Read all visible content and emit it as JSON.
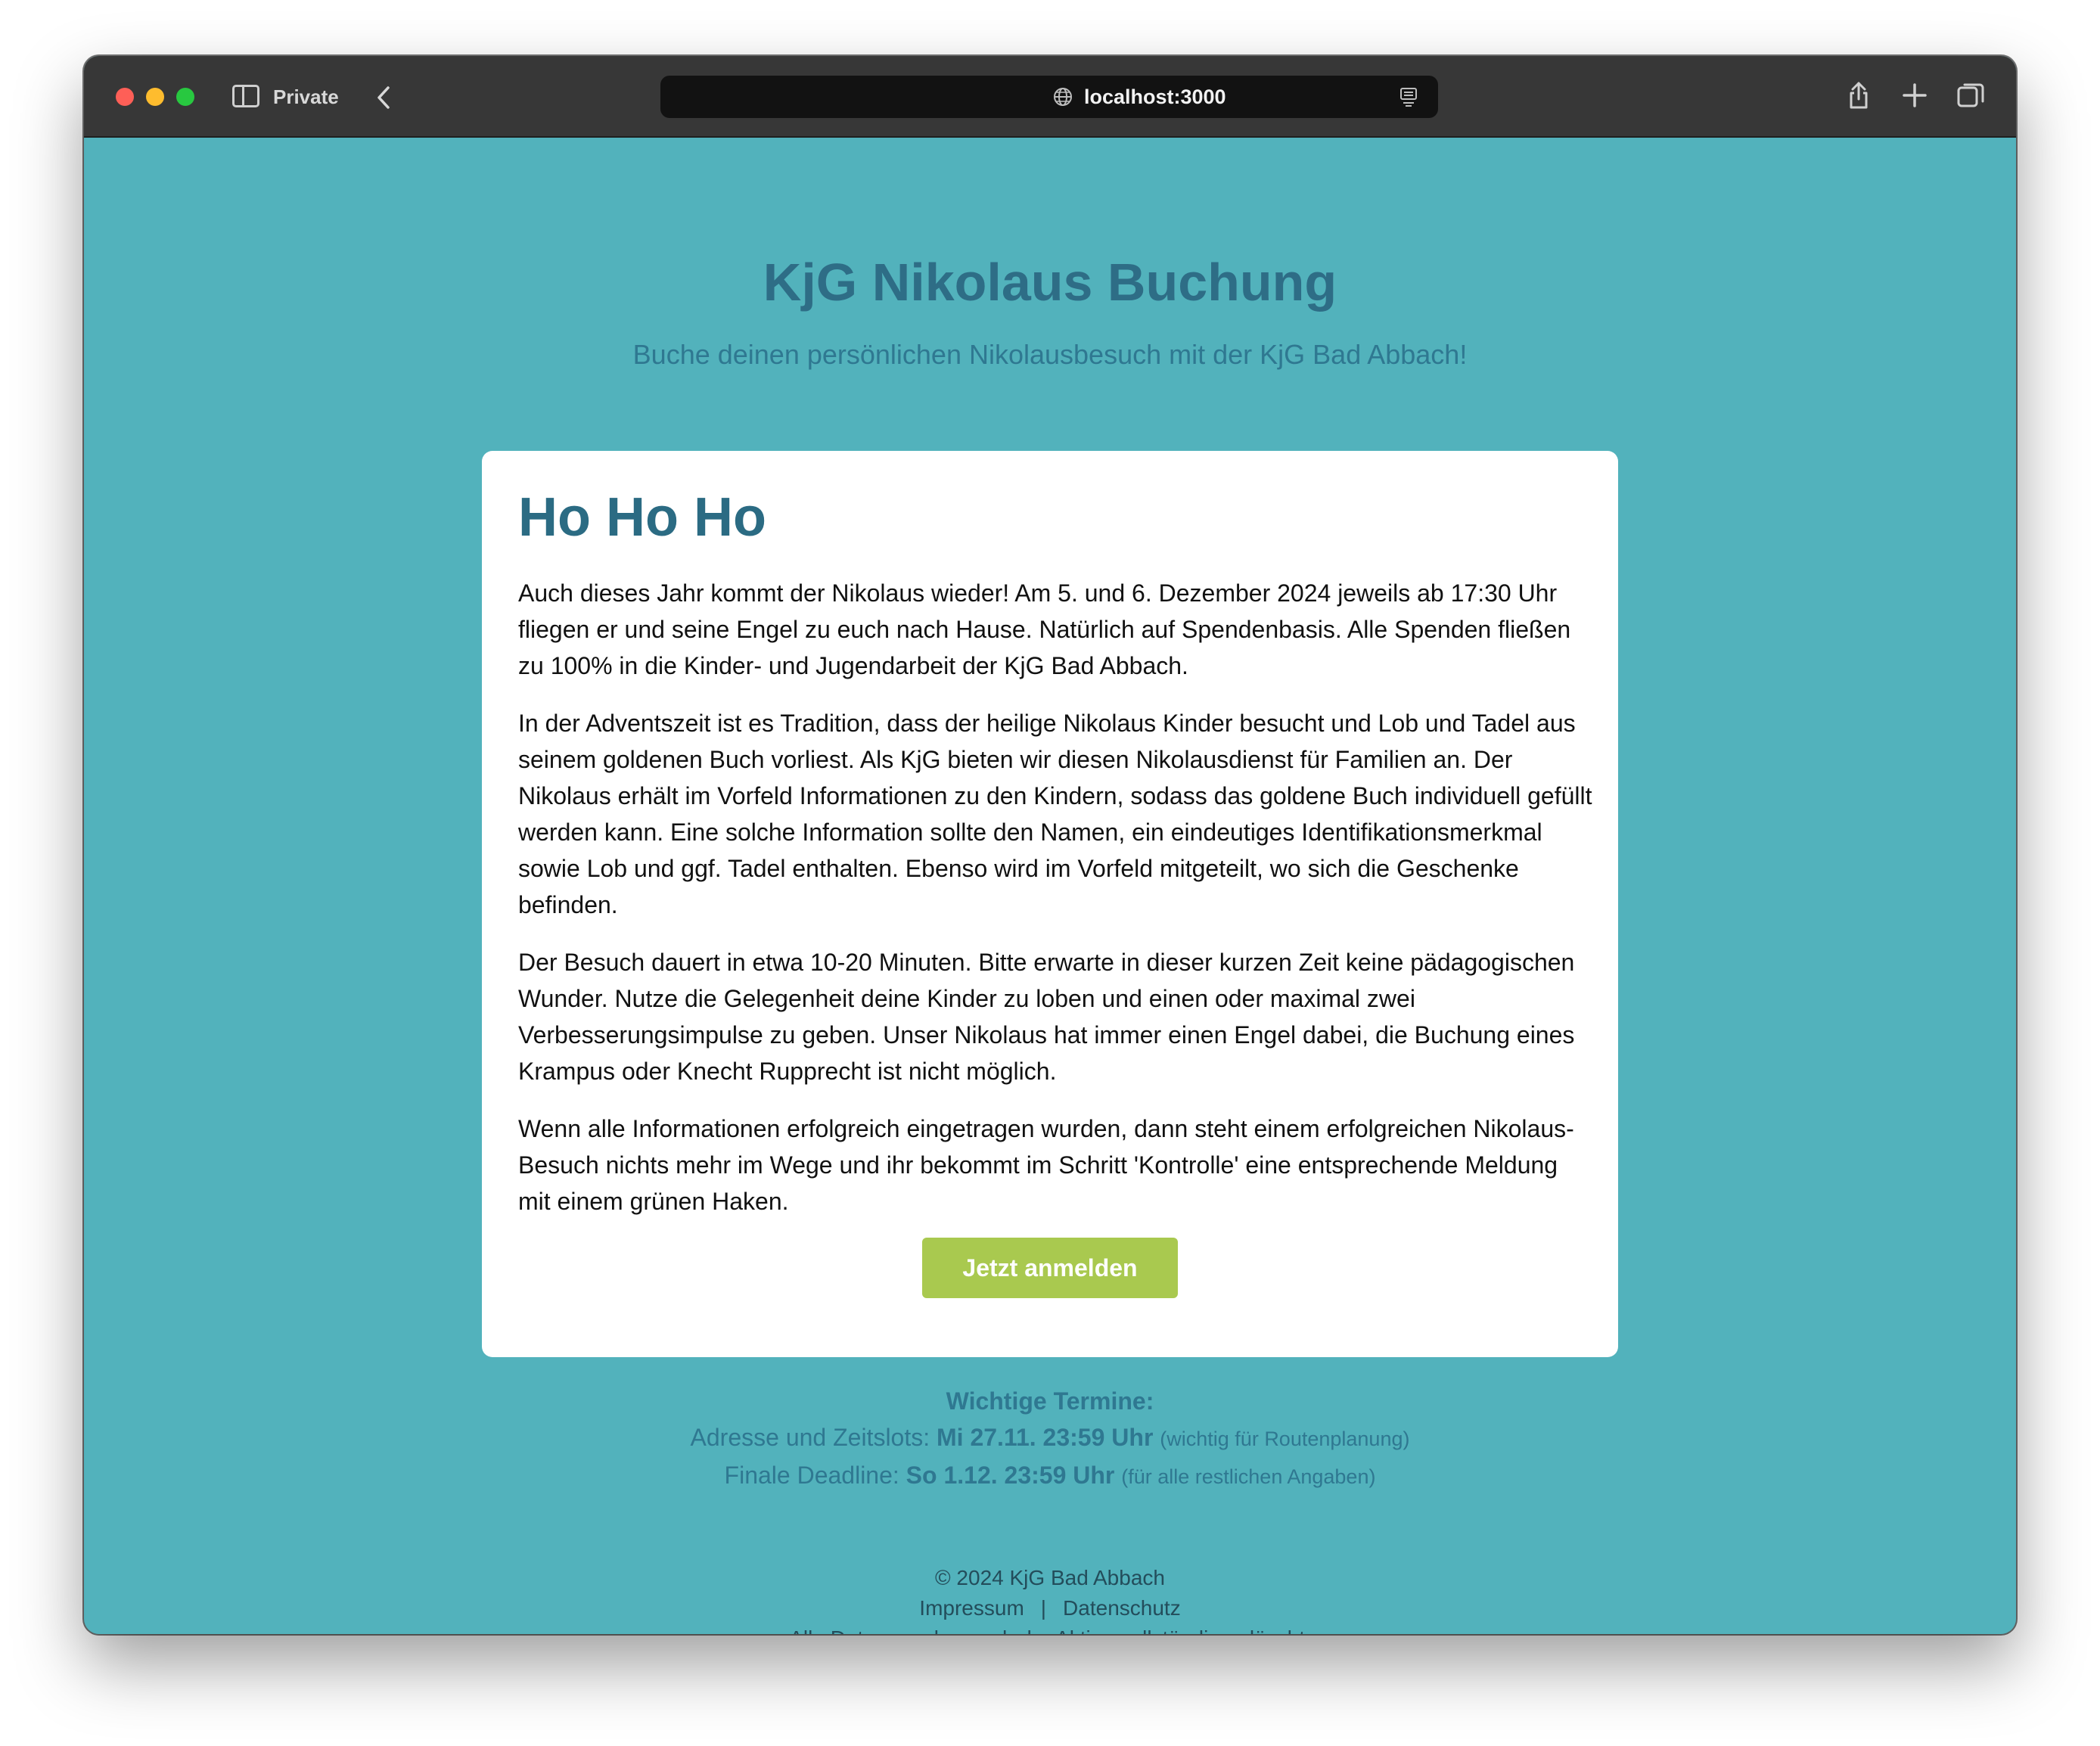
{
  "browser": {
    "mode_label": "Private",
    "url": "localhost:3000"
  },
  "header": {
    "title": "KjG Nikolaus Buchung",
    "subtitle": "Buche deinen persönlichen Nikolausbesuch mit der KjG Bad Abbach!"
  },
  "card": {
    "title": "Ho Ho Ho",
    "paragraphs": [
      "Auch dieses Jahr kommt der Nikolaus wieder! Am 5. und 6. Dezember 2024 jeweils ab 17:30 Uhr fliegen er und seine Engel zu euch nach Hause. Natürlich auf Spendenbasis. Alle Spenden fließen zu 100% in die Kinder- und Jugendarbeit der KjG Bad Abbach.",
      "In der Adventszeit ist es Tradition, dass der heilige Nikolaus Kinder besucht und Lob und Tadel aus seinem goldenen Buch vorliest. Als KjG bieten wir diesen Nikolausdienst für Familien an. Der Nikolaus erhält im Vorfeld Informationen zu den Kindern, sodass das goldene Buch individuell gefüllt werden kann. Eine solche Information sollte den Namen, ein eindeutiges Identifikationsmerkmal sowie Lob und ggf. Tadel enthalten. Ebenso wird im Vorfeld mitgeteilt, wo sich die Geschenke befinden.",
      "Der Besuch dauert in etwa 10-20 Minuten. Bitte erwarte in dieser kurzen Zeit keine pädagogischen Wunder. Nutze die Gelegenheit deine Kinder zu loben und einen oder maximal zwei Verbesserungsimpulse zu geben. Unser Nikolaus hat immer einen Engel dabei, die Buchung eines Krampus oder Knecht Rupprecht ist nicht möglich.",
      "Wenn alle Informationen erfolgreich eingetragen wurden, dann steht einem erfolgreichen Nikolaus-Besuch nichts mehr im Wege und ihr bekommt im Schritt 'Kontrolle' eine entsprechende Meldung mit einem grünen Haken."
    ],
    "button_label": "Jetzt anmelden"
  },
  "dates": {
    "heading": "Wichtige Termine:",
    "items": [
      {
        "label": "Adresse und Zeitslots:",
        "value": "Mi 27.11. 23:59 Uhr",
        "note": "(wichtig für Routenplanung)"
      },
      {
        "label": "Finale Deadline:",
        "value": "So 1.12. 23:59 Uhr",
        "note": "(für alle restlichen Angaben)"
      }
    ]
  },
  "footer": {
    "copyright": "© 2024 KjG Bad Abbach",
    "impressum": "Impressum",
    "separator": "|",
    "datenschutz": "Datenschutz",
    "notice": "Alle Daten werden nach der Aktion vollständig gelöscht."
  },
  "colors": {
    "page_background": "#52b2bc",
    "title": "#2e6d86",
    "button": "#a9c94f",
    "card": "#ffffff"
  }
}
